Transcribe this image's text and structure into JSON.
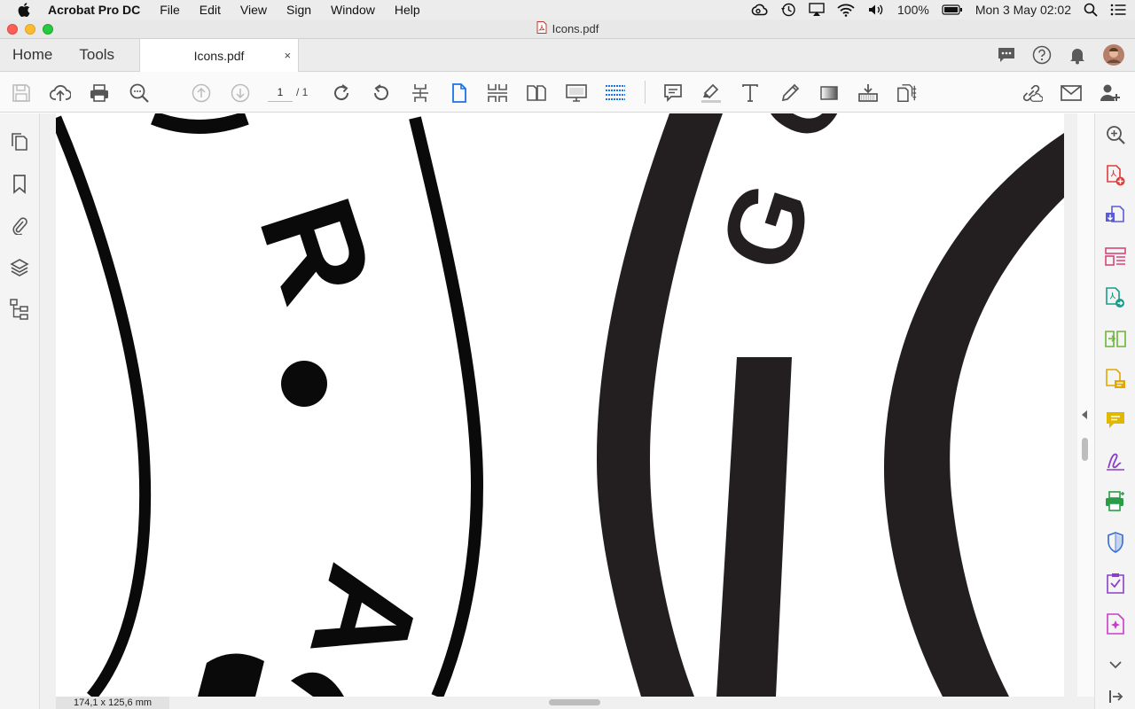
{
  "menubar": {
    "app_name": "Acrobat Pro DC",
    "menus": [
      "File",
      "Edit",
      "View",
      "Sign",
      "Window",
      "Help"
    ],
    "battery": "100%",
    "datetime": "Mon 3 May  02:02"
  },
  "window": {
    "title": "Icons.pdf"
  },
  "tabs": {
    "home": "Home",
    "tools": "Tools",
    "document": "Icons.pdf",
    "close": "×"
  },
  "toolbar": {
    "current_page": "1",
    "page_separator": "/ 1"
  },
  "status": {
    "dimensions": "174,1 x 125,6 mm"
  },
  "artwork": {
    "letters": [
      "R",
      "G",
      "O",
      "A"
    ]
  },
  "colors": {
    "accent_blue": "#1a73e8",
    "icon_gray": "#555555",
    "ink": "#231f20"
  }
}
